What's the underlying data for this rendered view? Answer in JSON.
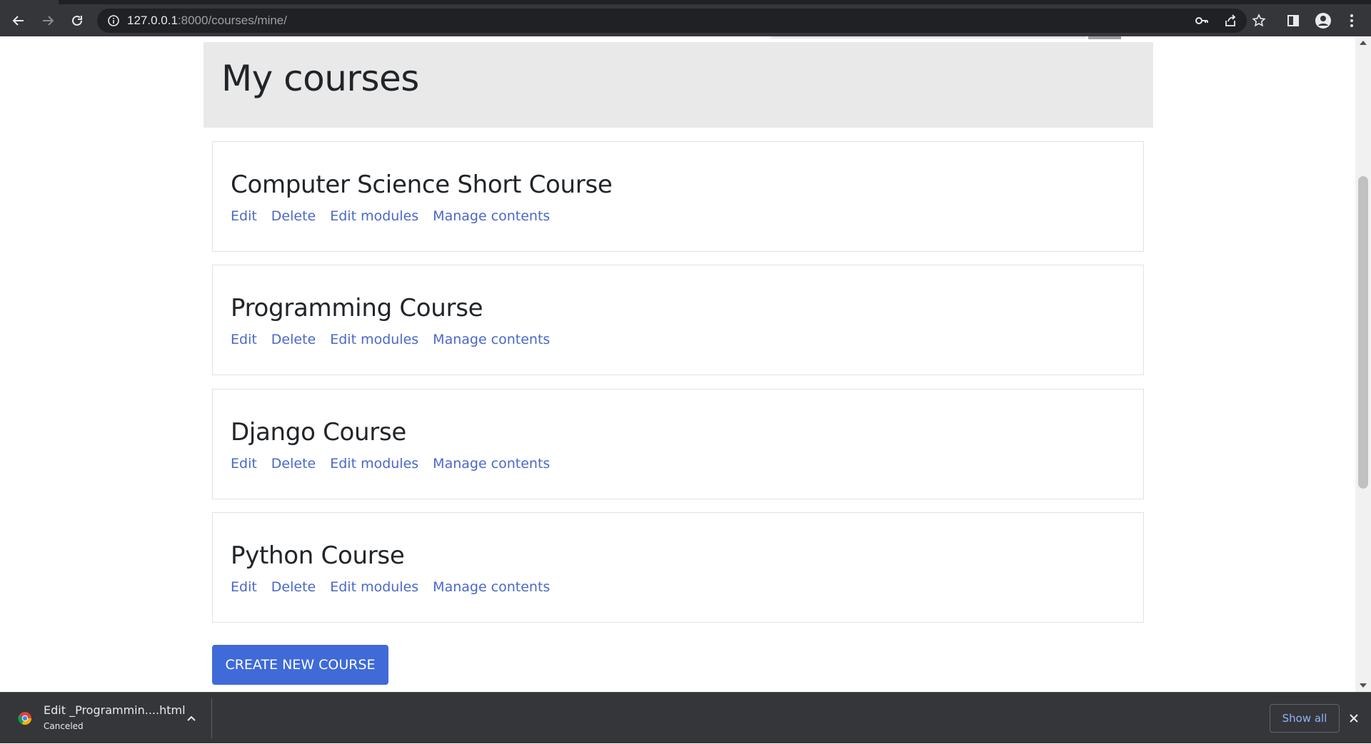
{
  "browser": {
    "url_host": "127.0.0.1",
    "url_path": ":8000/courses/mine/"
  },
  "page": {
    "title": "My courses",
    "courses": [
      {
        "title": "Computer Science Short Course",
        "links": [
          "Edit",
          "Delete",
          "Edit modules",
          "Manage contents"
        ]
      },
      {
        "title": "Programming Course",
        "links": [
          "Edit",
          "Delete",
          "Edit modules",
          "Manage contents"
        ]
      },
      {
        "title": "Django Course",
        "links": [
          "Edit",
          "Delete",
          "Edit modules",
          "Manage contents"
        ]
      },
      {
        "title": "Python Course",
        "links": [
          "Edit",
          "Delete",
          "Edit modules",
          "Manage contents"
        ]
      }
    ],
    "create_button": "CREATE NEW COURSE"
  },
  "download_shelf": {
    "file_name": "Edit _Programmin....html",
    "status": "Canceled",
    "show_all": "Show all"
  },
  "colors": {
    "link": "#4a68c9",
    "primary_button": "#3f6ad8",
    "jumbotron_bg": "#e9e9e9"
  }
}
